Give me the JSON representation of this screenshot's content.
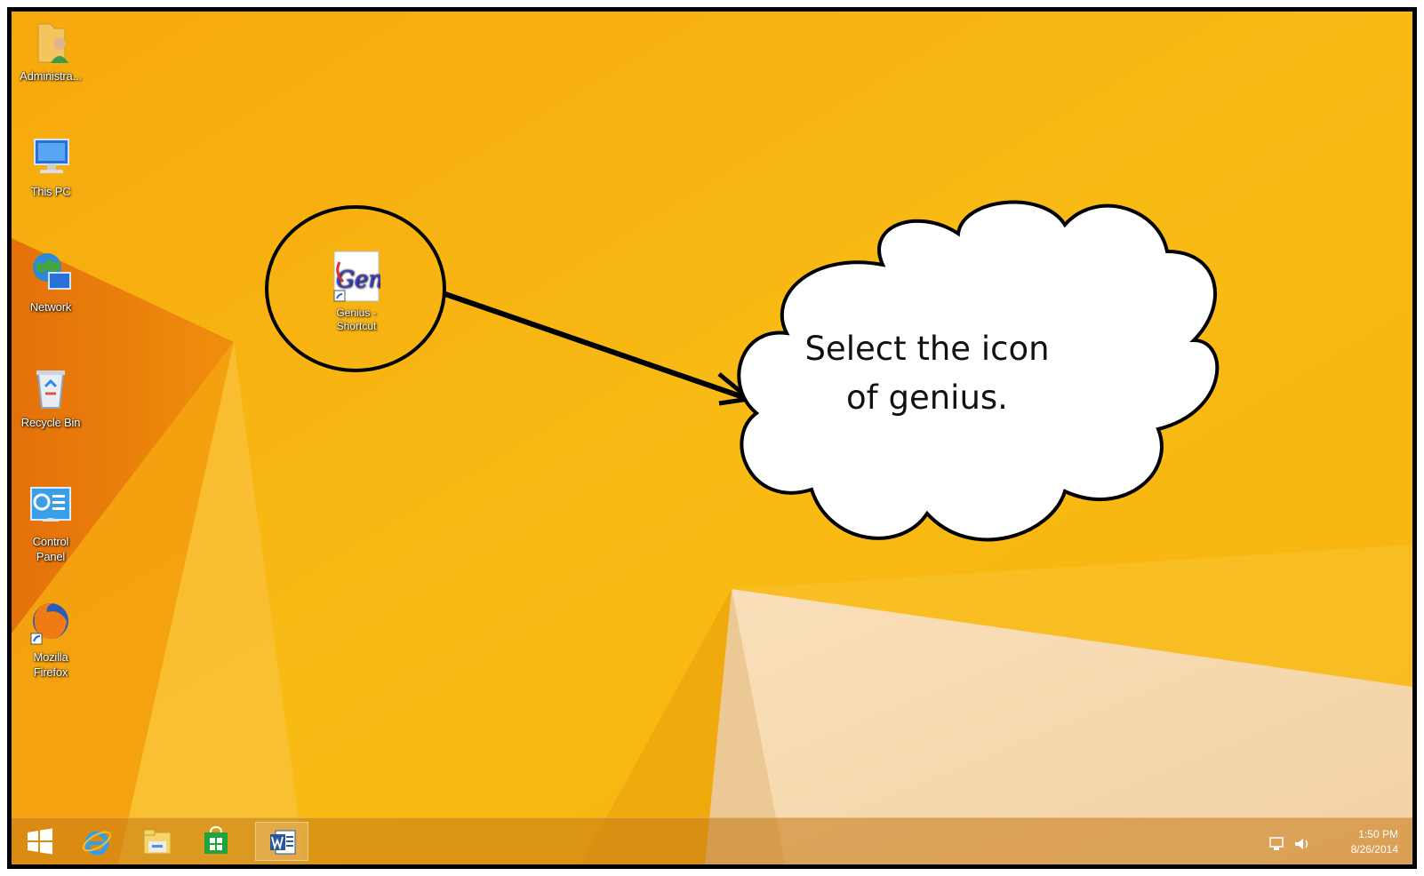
{
  "desktop": {
    "icons": [
      {
        "label": "Administra...",
        "icon": "user-folder-icon"
      },
      {
        "label": "This PC",
        "icon": "computer-icon"
      },
      {
        "label": "Network",
        "icon": "network-globe-icon"
      },
      {
        "label": "Recycle Bin",
        "icon": "recycle-bin-icon"
      },
      {
        "label": "Control Panel",
        "icon": "control-panel-icon"
      },
      {
        "label": "Mozilla Firefox",
        "icon": "firefox-icon"
      }
    ],
    "genius_shortcut": {
      "label": "Genius - Shortcut",
      "icon_text": "Gen",
      "icon": "genius-app-icon"
    }
  },
  "annotation": {
    "callout_line1": "Select the icon",
    "callout_line2": "of genius.",
    "stroke_color": "#000000",
    "fill_color": "#ffffff"
  },
  "taskbar": {
    "buttons": [
      {
        "name": "start",
        "icon": "windows-logo-icon"
      },
      {
        "name": "internet-explorer",
        "icon": "internet-explorer-icon"
      },
      {
        "name": "file-explorer",
        "icon": "file-explorer-icon"
      },
      {
        "name": "store",
        "icon": "store-icon"
      },
      {
        "name": "word",
        "icon": "word-icon"
      }
    ],
    "clock": {
      "time": "1:50 PM",
      "date": "8/26/2014"
    },
    "tray_icons": [
      "network-icon",
      "volume-icon"
    ]
  },
  "colors": {
    "wallpaper_base": "#f7b50f",
    "wallpaper_dark": "#e8790a",
    "wallpaper_light": "#fbe7c4"
  }
}
